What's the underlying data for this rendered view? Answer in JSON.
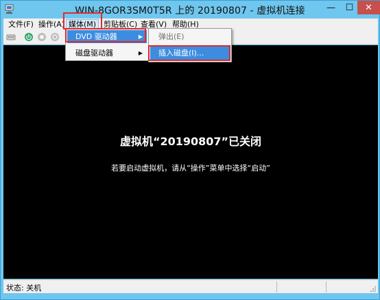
{
  "window": {
    "title": "WIN-8GOR3SM0T5R 上的 20190807 - 虚拟机连接",
    "min_glyph": "—",
    "max_glyph": "☐",
    "close_glyph": "✕"
  },
  "menubar": {
    "items": [
      "文件(F)",
      "操作(A)",
      "媒体(M)",
      "剪贴板(C)",
      "查看(V)",
      "帮助(H)"
    ],
    "active_index": 2
  },
  "media_menu": {
    "items": [
      "DVD 驱动器",
      "磁盘驱动器"
    ],
    "selected_index": 0
  },
  "dvd_menu": {
    "items": [
      "弹出(E)",
      "插入磁盘(I)..."
    ],
    "selected_index": 1,
    "disabled_index": 0
  },
  "screen": {
    "title": "虚拟机“20190807”已关闭",
    "hint": "若要启动虚拟机，请从“操作”菜单中选择“启动”"
  },
  "status": {
    "text": "状态: 关机"
  },
  "colors": {
    "titlebar": "#6fc6ee",
    "close": "#c7504c",
    "menu_selected": "#3c8de0",
    "highlight_border": "#e02a2a"
  }
}
